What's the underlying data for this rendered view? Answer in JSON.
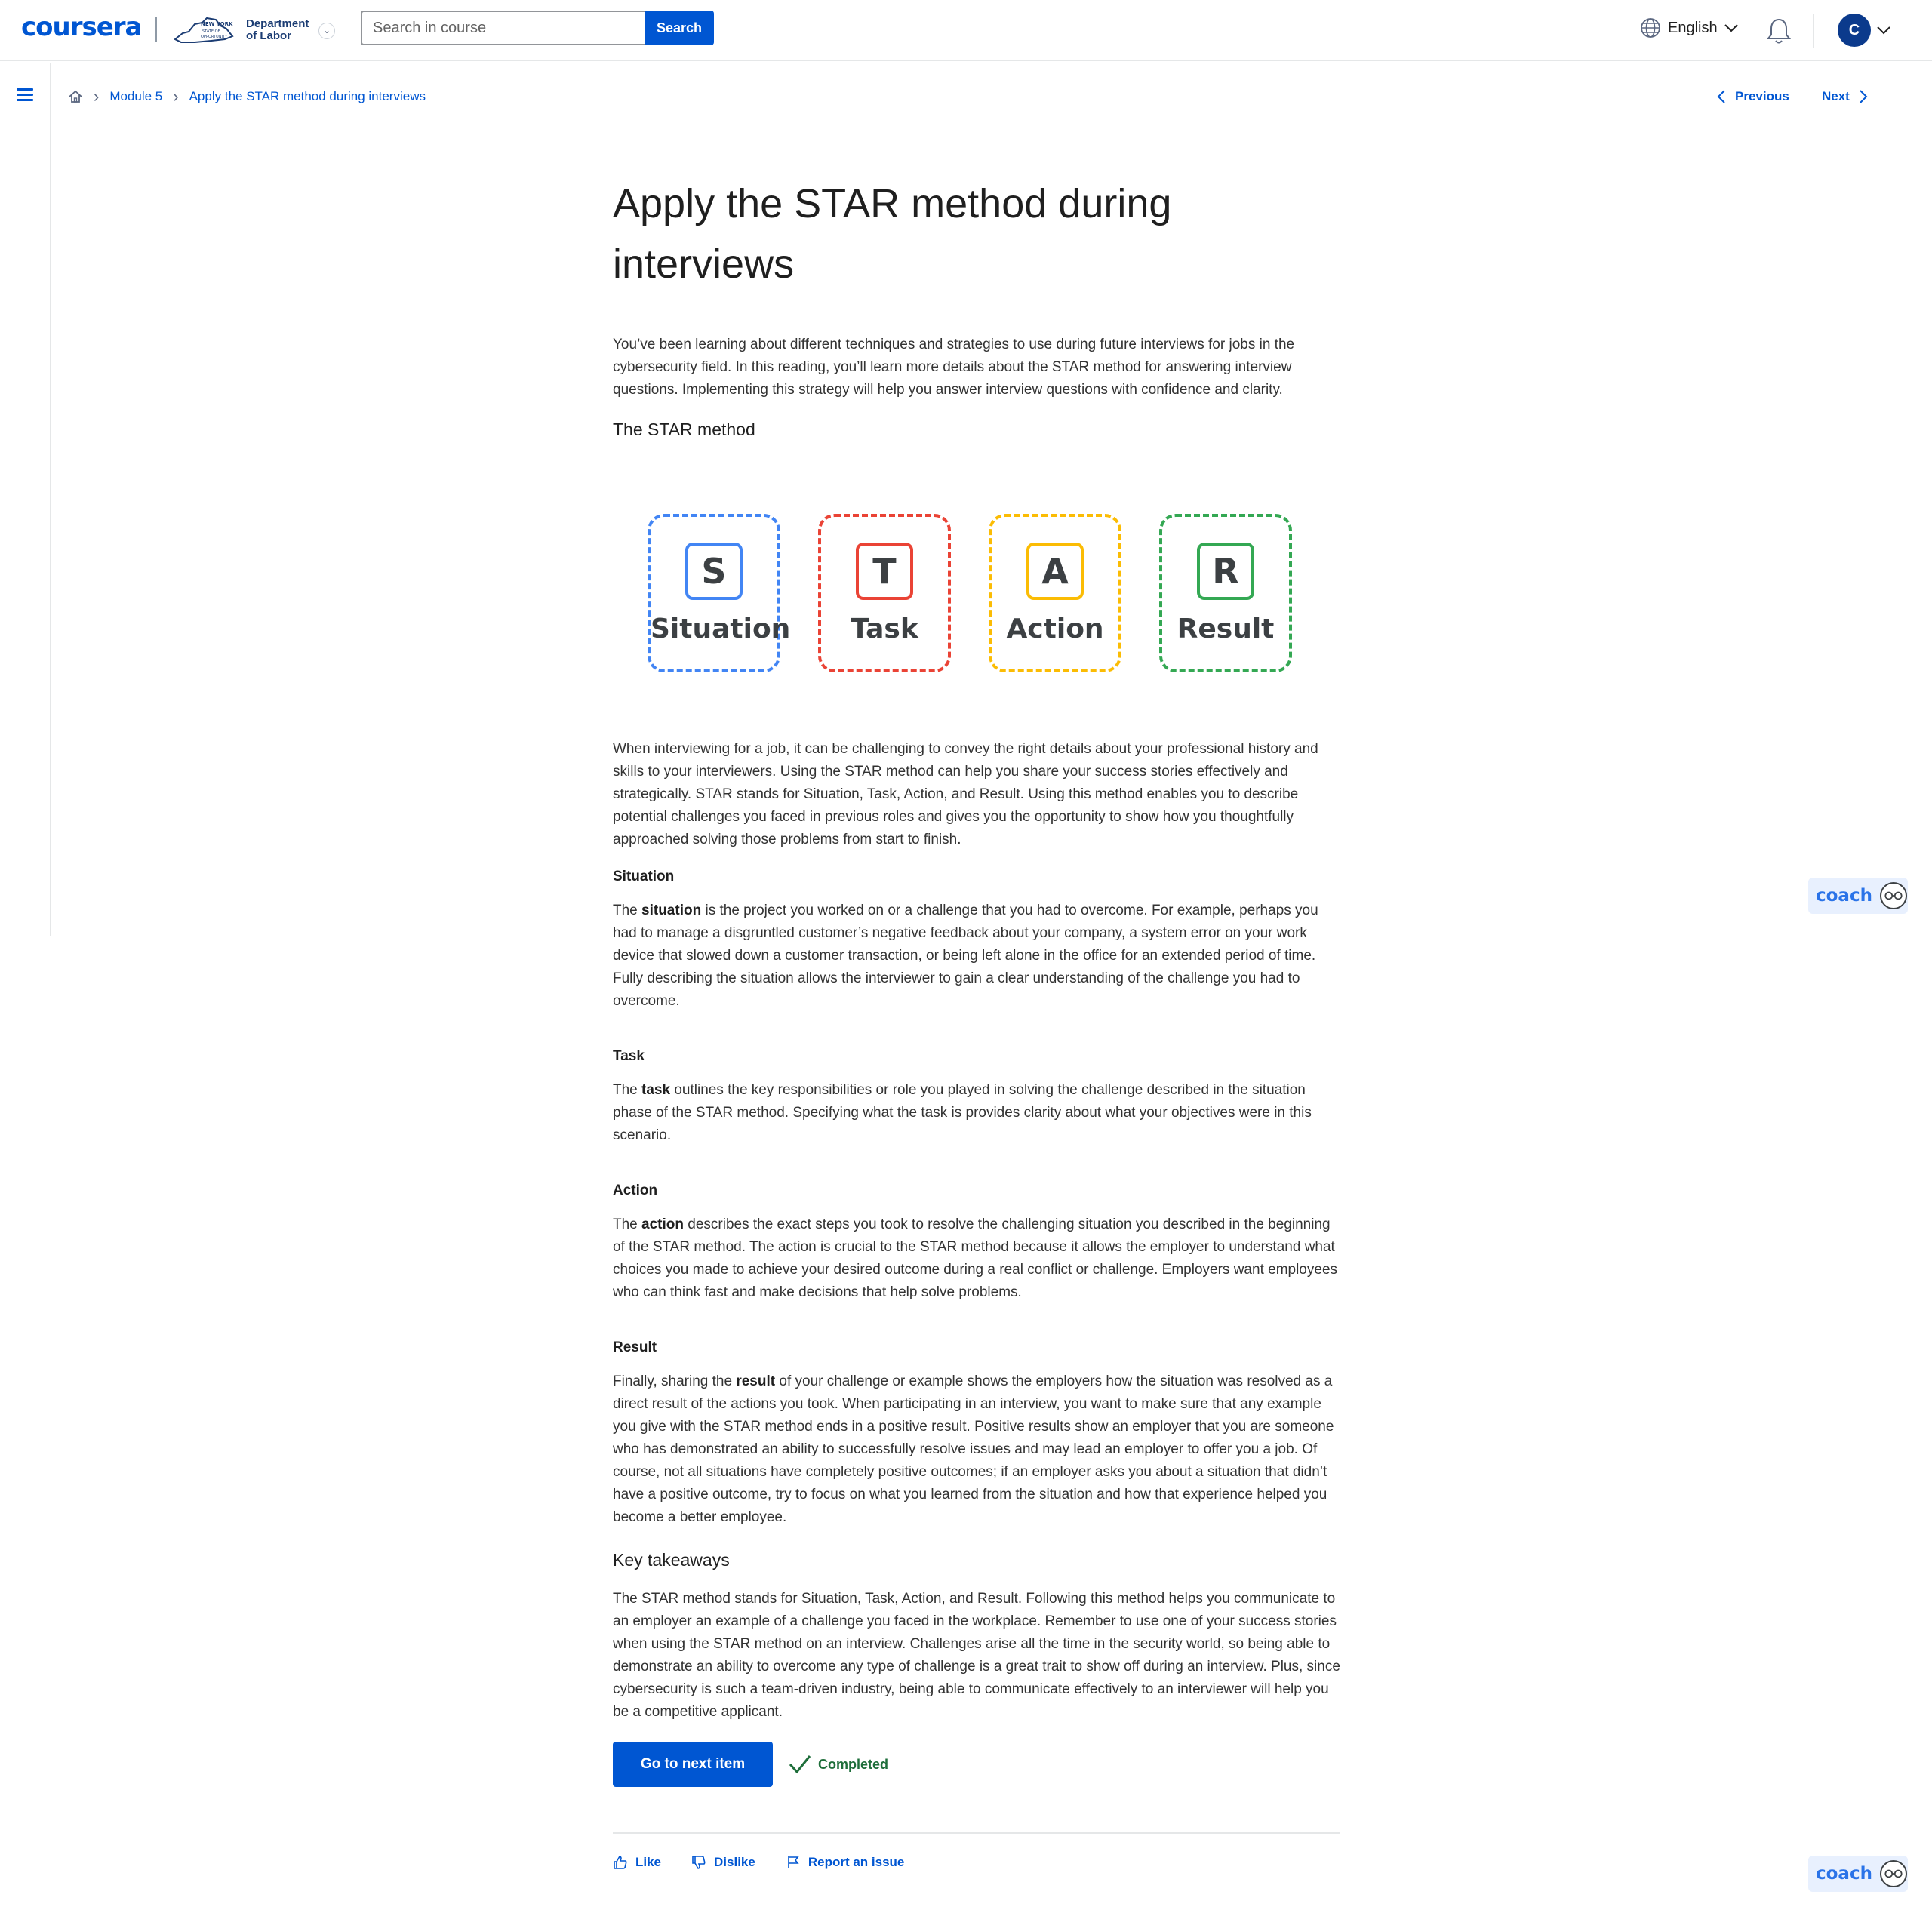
{
  "header": {
    "logo": "coursera",
    "partner_name": "Department of Labor",
    "partner_mark_text": "NEW YORK STATE OF OPPORTUNITY",
    "search_placeholder": "Search in course",
    "search_button": "Search",
    "language": "English",
    "avatar_initial": "C"
  },
  "breadcrumb": {
    "home_icon": "home-icon",
    "module": "Module 5",
    "current": "Apply the STAR method during interviews"
  },
  "nav": {
    "previous": "Previous",
    "next": "Next"
  },
  "article": {
    "title": "Apply the STAR method during interviews",
    "intro": "You’ve been learning about different techniques and strategies to use during future interviews for jobs in the cybersecurity field. In this reading, you’ll learn more details about the STAR method for answering interview questions. Implementing this strategy will help you answer interview questions with confidence and clarity.",
    "star_heading": "The STAR method",
    "star_cards": [
      {
        "letter": "S",
        "word": "Situation",
        "color": "#4285f4"
      },
      {
        "letter": "T",
        "word": "Task",
        "color": "#ea4335"
      },
      {
        "letter": "A",
        "word": "Action",
        "color": "#fbbc04"
      },
      {
        "letter": "R",
        "word": "Result",
        "color": "#34a853"
      }
    ],
    "star_para": "When interviewing for a job, it can be challenging to convey the right details about your professional history and skills to your interviewers. Using the STAR method can help you share your success stories effectively and strategically. STAR stands for Situation, Task, Action, and Result. Using this method enables you to describe potential challenges you faced in previous roles and gives you the opportunity to show how you thoughtfully approached solving those problems from start to finish.",
    "situation": {
      "heading": "Situation",
      "pre": "The ",
      "term": "situation",
      "post": " is the project you worked on or a challenge that you had to overcome. For example, perhaps you had to manage a disgruntled customer’s negative feedback about your company,  a system error on your work device that slowed down a customer transaction, or being left alone in the office for an extended period of time. Fully describing the situation allows the interviewer to gain a clear understanding of the challenge you had to overcome."
    },
    "task": {
      "heading": "Task",
      "pre": "The ",
      "term": "task",
      "post": " outlines the key responsibilities or role you played in solving the challenge described in the situation phase of the STAR method. Specifying what the task is provides clarity about what your objectives were in this scenario."
    },
    "action": {
      "heading": "Action",
      "pre": "The ",
      "term": "action",
      "post": " describes the exact steps you took to resolve the challenging situation you described in the beginning of the STAR method. The action is crucial to the STAR method because it allows the employer to understand what choices you made to achieve your desired outcome during a real conflict or challenge. Employers want employees who can think fast and make decisions that help solve problems."
    },
    "result": {
      "heading": "Result",
      "pre": "Finally, sharing the ",
      "term": "result",
      "post": " of your challenge or example shows the employers how the situation was resolved as a direct result of the actions you took. When participating in an interview, you want to make sure that any example you give with the STAR method ends in a positive result. Positive results show an employer that you are someone who has demonstrated an ability to successfully resolve issues and may lead an employer to offer you a job. Of course, not all situations have completely positive outcomes; if an employer asks you about a situation that didn’t have a positive outcome, try to focus on what you learned from the situation and how that experience helped you become a better employee."
    },
    "takeaways_heading": "Key takeaways",
    "takeaways": "The STAR method stands for Situation, Task, Action, and Result. Following this method helps you communicate to an employer an example of a challenge you faced in the workplace. Remember to use one of your success stories when using the STAR method on an interview. Challenges arise all the time in the security world, so being able to demonstrate an ability to overcome any type of challenge is a great trait to show off during an interview. Plus, since cybersecurity is such a team-driven industry, being able to communicate effectively to an interviewer will help you be a competitive applicant."
  },
  "actions": {
    "next_item": "Go to next item",
    "completed": "Completed",
    "like": "Like",
    "dislike": "Dislike",
    "report": "Report an issue"
  },
  "coach": {
    "label": "coach"
  },
  "colors": {
    "primary": "#0056d2",
    "completed": "#1e6e3a",
    "coach": "#2a73e8"
  }
}
